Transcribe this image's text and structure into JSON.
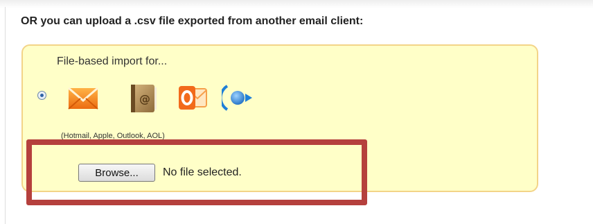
{
  "upload_section": {
    "heading": "OR you can upload a .csv file exported from another email client:",
    "import_box": {
      "title": "File-based import for...",
      "radio_selected": true,
      "icons": [
        "hotmail-icon",
        "apple-address-book-icon",
        "outlook-icon",
        "aol-icon"
      ],
      "caption": "(Hotmail, Apple, Outlook, AOL)"
    },
    "file_input": {
      "button_label": "Browse...",
      "status_text": "No file selected."
    }
  },
  "colors": {
    "box_background": "#ffffc8",
    "box_border": "#f3d488",
    "highlight_frame": "#b5403d",
    "hotmail_orange": "#f58220",
    "outlook_orange": "#f26a1b",
    "aol_blue": "#1e7fd8"
  }
}
